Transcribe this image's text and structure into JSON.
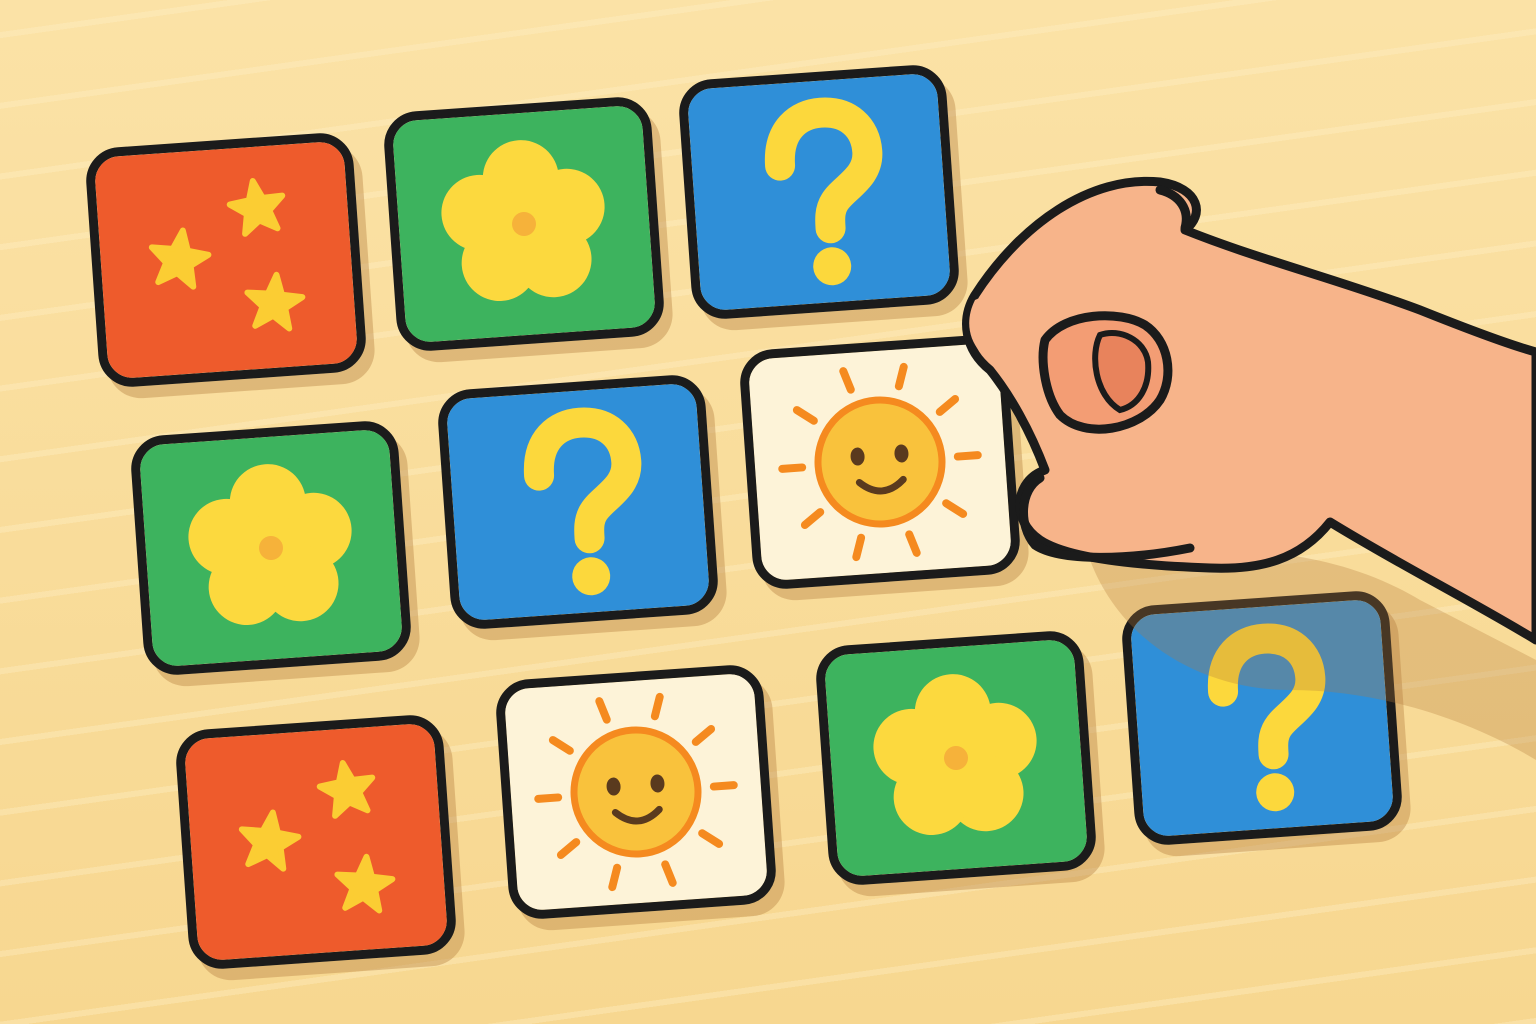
{
  "game": {
    "card_types": {
      "stars": {
        "icon": "three-stars-icon",
        "face_color": "#ee5b2c",
        "symbol_color": "#fbcd33"
      },
      "flower": {
        "icon": "flower-icon",
        "face_color": "#3db35e",
        "symbol_color": "#fcd93e",
        "center_color": "#f6b23a"
      },
      "hidden": {
        "icon": "question-mark-icon",
        "face_color": "#2f8fd8",
        "symbol_color": "#fcd83c"
      },
      "sun": {
        "icon": "smiling-sun-icon",
        "face_color": "#fdf3d8",
        "symbol_color": "#f9c23c",
        "ray_color": "#f58a1f"
      }
    },
    "board": {
      "rows": 3,
      "cards": [
        {
          "row": 1,
          "col": 1,
          "type": "stars",
          "state": "face-up"
        },
        {
          "row": 1,
          "col": 2,
          "type": "flower",
          "state": "face-up"
        },
        {
          "row": 1,
          "col": 3,
          "type": "hidden",
          "state": "face-down"
        },
        {
          "row": 2,
          "col": 1,
          "type": "flower",
          "state": "face-up"
        },
        {
          "row": 2,
          "col": 2,
          "type": "hidden",
          "state": "face-down"
        },
        {
          "row": 2,
          "col": 3,
          "type": "sun",
          "state": "being-picked-up"
        },
        {
          "row": 3,
          "col": 1,
          "type": "stars",
          "state": "face-up"
        },
        {
          "row": 3,
          "col": 2,
          "type": "sun",
          "state": "face-up"
        },
        {
          "row": 3,
          "col": 3,
          "type": "flower",
          "state": "face-up"
        },
        {
          "row": 3,
          "col": 4,
          "type": "hidden",
          "state": "face-down"
        }
      ]
    },
    "hand": {
      "icon": "hand-icon",
      "skin_color": "#f7b48a"
    },
    "outline_color": "#1b1b1b",
    "table_color": "#f9dc9c"
  }
}
